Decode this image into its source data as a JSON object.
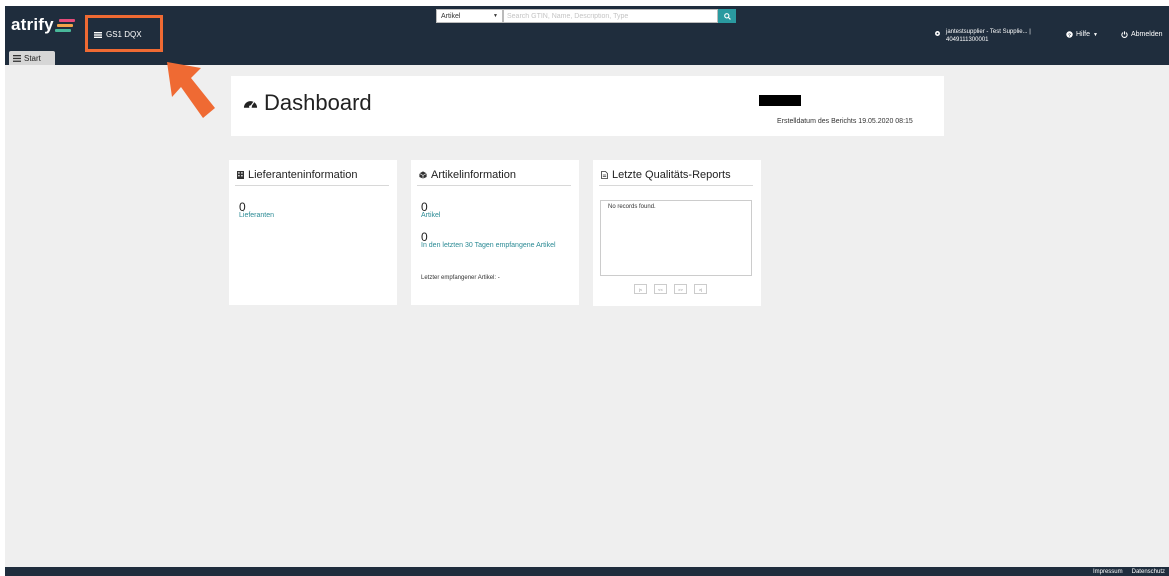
{
  "brand": {
    "name": "atrify",
    "colors": [
      "#e64b7a",
      "#f2a34a",
      "#49b89a"
    ]
  },
  "nav": {
    "start_label": "Start",
    "gs1_label": "GS1 DQX"
  },
  "search": {
    "type": "Artikel",
    "placeholder": "Search GTIN, Name, Description, Type"
  },
  "user": {
    "name": "jantestsupplier - Test Supplie... |",
    "gln": "4049111300001"
  },
  "menu": {
    "help": "Hilfe",
    "logout": "Abmelden"
  },
  "dashboard": {
    "title": "Dashboard",
    "report_date": "Erstelldatum des Berichts 19.05.2020 08:15"
  },
  "supplier_panel": {
    "title": "Lieferanteninformation",
    "count": "0",
    "count_label": "Lieferanten"
  },
  "article_panel": {
    "title": "Artikelinformation",
    "count": "0",
    "count_label": "Artikel",
    "recent_count": "0",
    "recent_label": "In den letzten 30 Tagen empfangene Artikel",
    "last_received": "Letzter empfangener Artikel: -"
  },
  "quality_panel": {
    "title": "Letzte Qualitäts-Reports",
    "empty": "No records found.",
    "pager": [
      "|<",
      "<<",
      ">>",
      ">|"
    ]
  },
  "footer": {
    "imprint": "Impressum",
    "privacy": "Datenschutz"
  },
  "colors": {
    "topbar": "#1f2d3d",
    "accent": "#2a9aa0",
    "highlight": "#ef6a33",
    "background": "#efefef"
  }
}
